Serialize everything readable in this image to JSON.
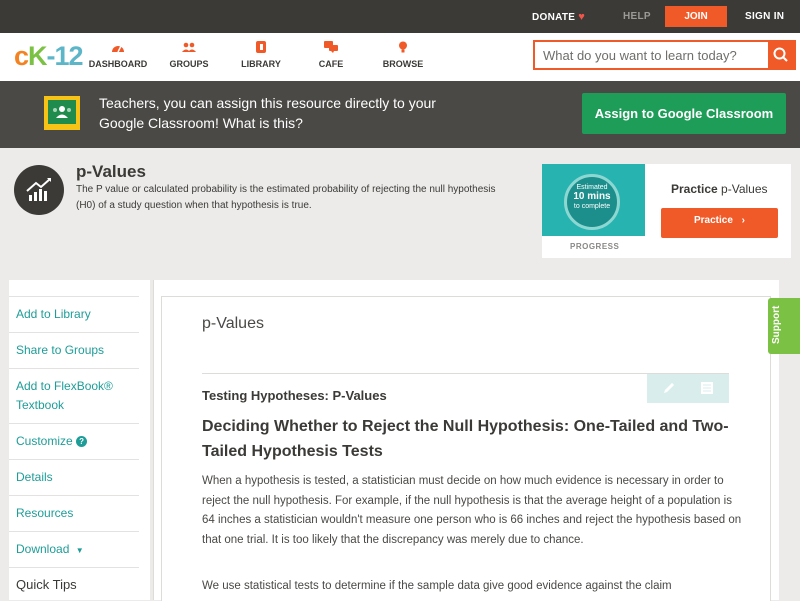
{
  "topbar": {
    "donate": "DONATE",
    "help": "HELP",
    "join": "JOIN",
    "signin": "SIGN IN"
  },
  "nav": {
    "logo": {
      "c": "c",
      "k": "K",
      "n": "-12"
    },
    "items": [
      {
        "label": "DASHBOARD",
        "icon": "dashboard-icon"
      },
      {
        "label": "GROUPS",
        "icon": "groups-icon"
      },
      {
        "label": "LIBRARY",
        "icon": "library-icon"
      },
      {
        "label": "CAFE",
        "icon": "cafe-icon"
      },
      {
        "label": "BROWSE",
        "icon": "browse-icon"
      }
    ],
    "search_placeholder": "What do you want to learn today?"
  },
  "banner": {
    "message": "Teachers, you can assign this resource directly to your Google Classroom!",
    "what": "What is this?",
    "assign": "Assign to Google Classroom"
  },
  "concept": {
    "title": "p-Values",
    "description": "The P value or calculated probability is the estimated probability of rejecting the null hypothesis (H0) of a study question when that hypothesis is true."
  },
  "practice": {
    "estimated": "Estimated",
    "mins": "10 mins",
    "to_complete": "to complete",
    "progress": "PROGRESS",
    "title_prefix": "Practice",
    "title_name": "p-Values",
    "button": "Practice"
  },
  "sidebar": {
    "items": [
      "Add to Library",
      "Share to Groups",
      "Add to FlexBook®",
      "Textbook",
      "Customize",
      "Details",
      "Resources",
      "Download"
    ],
    "quick_tips": "Quick Tips"
  },
  "content": {
    "title": "p-Values",
    "subtitle": "Testing Hypotheses: P-Values",
    "heading": "Deciding Whether to Reject the Null Hypothesis: One-Tailed and Two-Tailed Hypothesis Tests",
    "para1": "When a hypothesis is tested, a statistician must decide on how much evidence is necessary in order to reject the null hypothesis. For example, if the null hypothesis is that the average height of a population is 64 inches a statistician wouldn't measure one person who is 66 inches and reject the hypothesis based on that one trial. It is too likely that the discrepancy was merely due to chance.",
    "para2": "We use statistical tests to determine if the sample data give good evidence against the claim"
  },
  "support": "Support",
  "colors": {
    "accent": "#f05a28",
    "green": "#1e9d58",
    "teal": "#1e9d98",
    "dark": "#3b3a37"
  }
}
